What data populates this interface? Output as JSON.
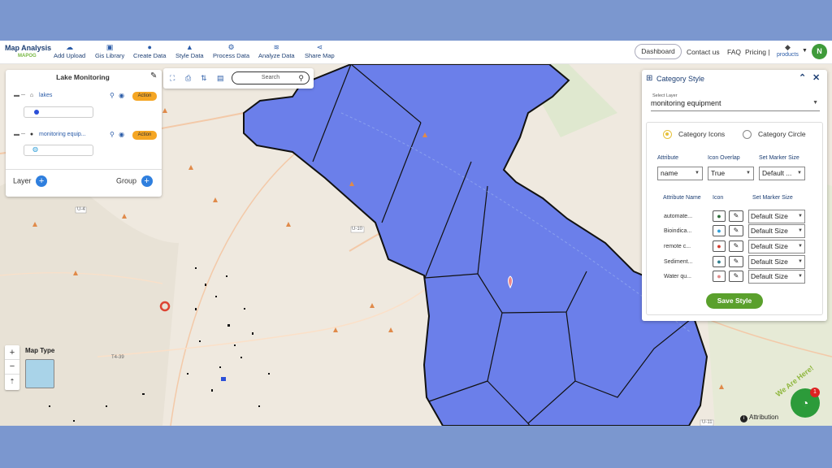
{
  "app": {
    "title": "Map Analysis",
    "logo": "MAPOG"
  },
  "nav": [
    {
      "label": "Add Upload",
      "icon": "cloud-upload-icon"
    },
    {
      "label": "Gis Library",
      "icon": "library-icon"
    },
    {
      "label": "Create Data",
      "icon": "map-pin-icon"
    },
    {
      "label": "Style Data",
      "icon": "paint-bucket-icon"
    },
    {
      "label": "Process Data",
      "icon": "process-icon"
    },
    {
      "label": "Analyze Data",
      "icon": "analyze-icon"
    },
    {
      "label": "Share Map",
      "icon": "share-icon"
    }
  ],
  "topright": {
    "dashboard": "Dashboard",
    "contact": "Contact us",
    "faq": "FAQ",
    "pricing": "Pricing |",
    "products": "products",
    "avatar": "N"
  },
  "layer_panel": {
    "title": "Lake Monitoring",
    "layers": [
      {
        "name": "lakes",
        "action": "Action"
      },
      {
        "name": "monitoring equip...",
        "action": "Action"
      }
    ],
    "layer_label": "Layer",
    "group_label": "Group"
  },
  "toolbar": {
    "search_placeholder": "Search"
  },
  "map": {
    "map_type": "Map Type",
    "attribution": "Attribution",
    "chat_badge": "1",
    "we_are_here": "We Are Here!",
    "road_u10": "U-10",
    "road_u11": "U-11",
    "road_u4": "U-4",
    "road_t439": "T4-39"
  },
  "category_style": {
    "title": "Category Style",
    "select_layer_label": "Select Layer",
    "select_layer_value": "monitoring equipment",
    "radio_icons": "Category Icons",
    "radio_circle": "Category Circle",
    "attribute_label": "Attribute",
    "icon_overlap_label": "Icon Overlap",
    "marker_size_label": "Set Marker Size",
    "attribute_value": "name",
    "icon_overlap_value": "True",
    "marker_size_value": "Default ...",
    "table_headers": {
      "name": "Attribute Name",
      "icon": "Icon",
      "size": "Set Marker Size"
    },
    "rows": [
      {
        "name": "automate...",
        "size": "Default Size",
        "color": "#2c6e3a"
      },
      {
        "name": "Bioindica...",
        "size": "Default Size",
        "color": "#2e9ed8"
      },
      {
        "name": "remote c...",
        "size": "Default Size",
        "color": "#d23b2e"
      },
      {
        "name": "Sediment...",
        "size": "Default Size",
        "color": "#2f7f8f"
      },
      {
        "name": "Water qu...",
        "size": "Default Size",
        "color": "#e08a8a"
      }
    ],
    "save": "Save Style"
  }
}
